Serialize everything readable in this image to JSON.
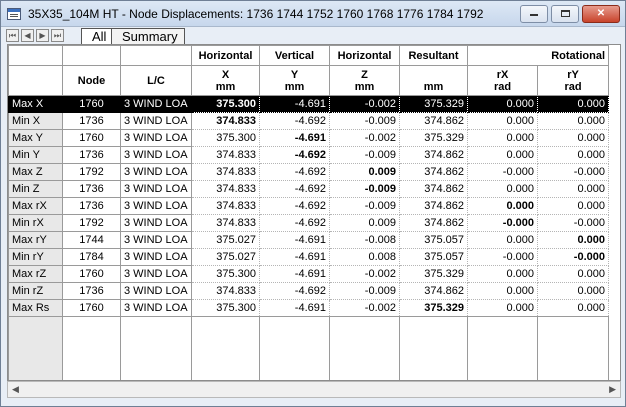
{
  "window": {
    "title": "35X35_104M HT - Node Displacements: 1736 1744 1752 1760 1768 1776 1784 1792"
  },
  "tabs": [
    {
      "label": "All",
      "active": true
    },
    {
      "label": "Summary",
      "active": false
    }
  ],
  "table": {
    "group_headers": [
      "Horizontal",
      "Vertical",
      "Horizontal",
      "Resultant",
      "Rotational"
    ],
    "col_headers": {
      "node": "Node",
      "lc": "L/C",
      "x": [
        "X",
        "mm"
      ],
      "y": [
        "Y",
        "mm"
      ],
      "z": [
        "Z",
        "mm"
      ],
      "res": [
        "",
        "mm"
      ],
      "rx": [
        "rX",
        "rad"
      ],
      "ry": [
        "rY",
        "rad"
      ]
    },
    "rows": [
      {
        "label": "Max X",
        "node": "1760",
        "lc": "3 WIND LOA",
        "x": "375.300",
        "y": "-4.691",
        "z": "-0.002",
        "res": "375.329",
        "rx": "0.000",
        "ry": "0.000",
        "bold": "x",
        "selected": true
      },
      {
        "label": "Min X",
        "node": "1736",
        "lc": "3 WIND LOA",
        "x": "374.833",
        "y": "-4.692",
        "z": "-0.009",
        "res": "374.862",
        "rx": "0.000",
        "ry": "0.000",
        "bold": "x"
      },
      {
        "label": "Max Y",
        "node": "1760",
        "lc": "3 WIND LOA",
        "x": "375.300",
        "y": "-4.691",
        "z": "-0.002",
        "res": "375.329",
        "rx": "0.000",
        "ry": "0.000",
        "bold": "y"
      },
      {
        "label": "Min Y",
        "node": "1736",
        "lc": "3 WIND LOA",
        "x": "374.833",
        "y": "-4.692",
        "z": "-0.009",
        "res": "374.862",
        "rx": "0.000",
        "ry": "0.000",
        "bold": "y"
      },
      {
        "label": "Max Z",
        "node": "1792",
        "lc": "3 WIND LOA",
        "x": "374.833",
        "y": "-4.692",
        "z": "0.009",
        "res": "374.862",
        "rx": "-0.000",
        "ry": "-0.000",
        "bold": "z"
      },
      {
        "label": "Min Z",
        "node": "1736",
        "lc": "3 WIND LOA",
        "x": "374.833",
        "y": "-4.692",
        "z": "-0.009",
        "res": "374.862",
        "rx": "0.000",
        "ry": "0.000",
        "bold": "z"
      },
      {
        "label": "Max rX",
        "node": "1736",
        "lc": "3 WIND LOA",
        "x": "374.833",
        "y": "-4.692",
        "z": "-0.009",
        "res": "374.862",
        "rx": "0.000",
        "ry": "0.000",
        "bold": "rx"
      },
      {
        "label": "Min rX",
        "node": "1792",
        "lc": "3 WIND LOA",
        "x": "374.833",
        "y": "-4.692",
        "z": "0.009",
        "res": "374.862",
        "rx": "-0.000",
        "ry": "-0.000",
        "bold": "rx"
      },
      {
        "label": "Max rY",
        "node": "1744",
        "lc": "3 WIND LOA",
        "x": "375.027",
        "y": "-4.691",
        "z": "-0.008",
        "res": "375.057",
        "rx": "0.000",
        "ry": "0.000",
        "bold": "ry"
      },
      {
        "label": "Min rY",
        "node": "1784",
        "lc": "3 WIND LOA",
        "x": "375.027",
        "y": "-4.691",
        "z": "0.008",
        "res": "375.057",
        "rx": "-0.000",
        "ry": "-0.000",
        "bold": "ry"
      },
      {
        "label": "Max rZ",
        "node": "1760",
        "lc": "3 WIND LOA",
        "x": "375.300",
        "y": "-4.691",
        "z": "-0.002",
        "res": "375.329",
        "rx": "0.000",
        "ry": "0.000",
        "bold": ""
      },
      {
        "label": "Min rZ",
        "node": "1736",
        "lc": "3 WIND LOA",
        "x": "374.833",
        "y": "-4.692",
        "z": "-0.009",
        "res": "374.862",
        "rx": "0.000",
        "ry": "0.000",
        "bold": ""
      },
      {
        "label": "Max Rs",
        "node": "1760",
        "lc": "3 WIND LOA",
        "x": "375.300",
        "y": "-4.691",
        "z": "-0.002",
        "res": "375.329",
        "rx": "0.000",
        "ry": "0.000",
        "bold": "res"
      }
    ]
  },
  "controls": {
    "minimize_icon": "minimize-icon",
    "maximize_icon": "maximize-icon",
    "close_icon": "close-icon"
  }
}
